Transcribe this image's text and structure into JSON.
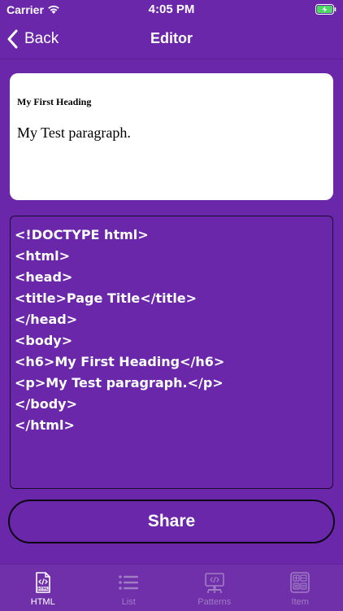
{
  "status_bar": {
    "carrier": "Carrier",
    "time": "4:05 PM",
    "wifi_icon": "wifi-icon",
    "battery_icon": "battery-charging-icon"
  },
  "nav": {
    "back_label": "Back",
    "title": "Editor"
  },
  "preview": {
    "heading": "My First Heading",
    "paragraph": "My Test paragraph."
  },
  "code": {
    "lines": [
      "<!DOCTYPE html>",
      "<html>",
      "<head>",
      "<title>Page Title</title>",
      "</head>",
      "<body>",
      "<h6>My First Heading</h6>",
      "<p>My Test paragraph.</p>",
      "</body>",
      "</html>"
    ]
  },
  "share_label": "Share",
  "tabs": [
    {
      "label": "HTML",
      "icon": "html-file-icon",
      "active": true
    },
    {
      "label": "List",
      "icon": "list-icon",
      "active": false
    },
    {
      "label": "Patterns",
      "icon": "monitor-code-icon",
      "active": false
    },
    {
      "label": "Item",
      "icon": "calculator-icon",
      "active": false
    }
  ],
  "colors": {
    "background": "#6a27a9",
    "tab_bar": "#7030aa",
    "active_tab": "#ffffff",
    "inactive_tab": "#a07cc4",
    "battery_fill": "#4cd964"
  }
}
